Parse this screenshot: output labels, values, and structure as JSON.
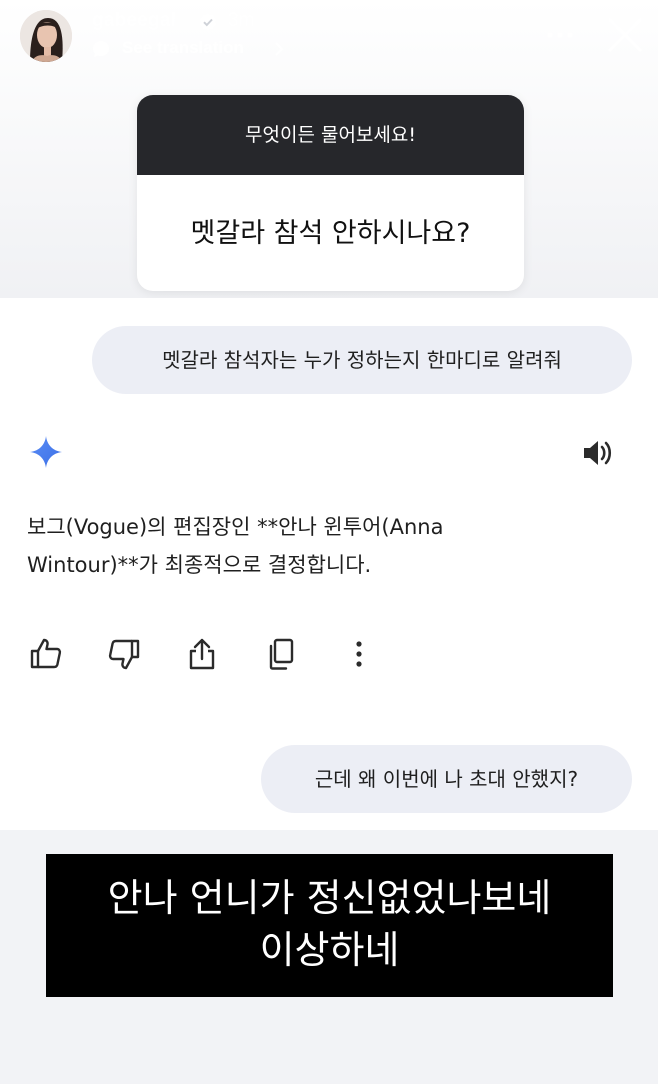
{
  "story": {
    "username": "gabeegal",
    "time": "3m",
    "see_translation": "See translation",
    "icons": {
      "avatar": "profile-avatar",
      "verified": "verified-badge-icon",
      "more": "more-horizontal-icon",
      "close": "close-icon"
    }
  },
  "question_sticker": {
    "prompt": "무엇이든 물어보세요!",
    "question": "멧갈라 참석 안하시나요?"
  },
  "chat": {
    "user_message_1": "멧갈라 참석자는 누가 정하는지 한마디로 알려줘",
    "answer_line_1": "보그(Vogue)의 편집장인 **안나 윈투어(Anna",
    "answer_line_2": "Wintour)**가 최종적으로 결정합니다.",
    "user_message_2": "근데 왜 이번에 나 초대 안했지?",
    "icons": [
      "gemini-sparkle-icon",
      "speaker-icon",
      "thumbs-up-icon",
      "thumbs-down-icon",
      "share-icon",
      "copy-icon",
      "more-vertical-icon"
    ],
    "colors": {
      "gemini_blue": "#4a7cf0",
      "bubble_bg": "#eceef5"
    }
  },
  "caption": {
    "line_1": "안나 언니가 정신없었나보네",
    "line_2": "이상하네"
  }
}
